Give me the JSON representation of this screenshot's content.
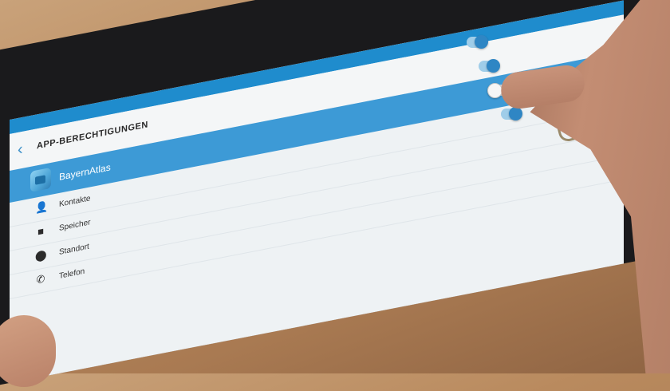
{
  "screen": {
    "title": "APP-BERECHTIGUNGEN",
    "back_glyph": "‹",
    "app": {
      "name": "BayernAtlas",
      "icon": "bayernatlas-app-icon"
    },
    "permissions": [
      {
        "label": "Kontakte",
        "icon": "contacts-icon",
        "glyph": "👤",
        "enabled": true
      },
      {
        "label": "Speicher",
        "icon": "folder-icon",
        "glyph": "■",
        "enabled": true
      },
      {
        "label": "Standort",
        "icon": "location-pin-icon",
        "glyph": "⬤",
        "enabled": false
      },
      {
        "label": "Telefon",
        "icon": "phone-icon",
        "glyph": "✆",
        "enabled": true
      }
    ]
  },
  "colors": {
    "accent": "#3d9ad6",
    "status_bar": "#1f8ccd",
    "toggle_on": "#2f86c4"
  }
}
